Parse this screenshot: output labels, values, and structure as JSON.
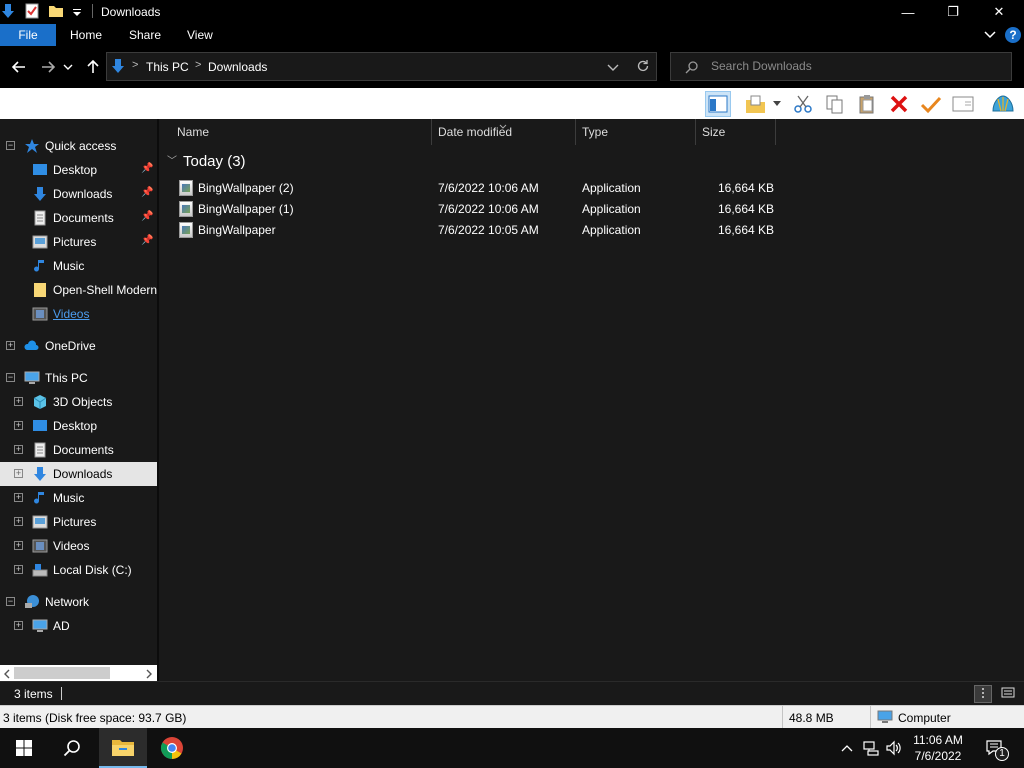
{
  "window": {
    "title": "Downloads",
    "minimize_glyph": "—",
    "maximize_glyph": "❐",
    "close_glyph": "✕"
  },
  "ribbon": {
    "tabs": [
      "File",
      "Home",
      "Share",
      "View"
    ],
    "help_glyph": "?"
  },
  "address": {
    "crumbs": [
      "This PC",
      "Downloads"
    ],
    "separator": ">"
  },
  "search": {
    "placeholder": "Search Downloads"
  },
  "nav": {
    "quick_access": {
      "label": "Quick access",
      "items": [
        "Desktop",
        "Downloads",
        "Documents",
        "Pictures",
        "Music",
        "Open-Shell Modern",
        "Videos"
      ]
    },
    "onedrive": "OneDrive",
    "this_pc": {
      "label": "This PC",
      "items": [
        "3D Objects",
        "Desktop",
        "Documents",
        "Downloads",
        "Music",
        "Pictures",
        "Videos",
        "Local Disk (C:)"
      ]
    },
    "network": {
      "label": "Network",
      "items": [
        "AD"
      ]
    }
  },
  "columns": [
    "Name",
    "Date modified",
    "Type",
    "Size"
  ],
  "group": "Today (3)",
  "files": [
    {
      "name": "BingWallpaper (2)",
      "date": "7/6/2022 10:06 AM",
      "type": "Application",
      "size": "16,664 KB"
    },
    {
      "name": "BingWallpaper (1)",
      "date": "7/6/2022 10:06 AM",
      "type": "Application",
      "size": "16,664 KB"
    },
    {
      "name": "BingWallpaper",
      "date": "7/6/2022 10:05 AM",
      "type": "Application",
      "size": "16,664 KB"
    }
  ],
  "status": {
    "items": "3 items"
  },
  "details": {
    "summary": "3 items (Disk free space: 93.7 GB)",
    "size": "48.8 MB",
    "location": "Computer"
  },
  "clock": {
    "time": "11:06 AM",
    "date": "7/6/2022"
  },
  "notifications": {
    "count": "1"
  },
  "colors": {
    "accent": "#1a6fc9",
    "bg": "#191919",
    "selected": "#e5e5e5"
  }
}
